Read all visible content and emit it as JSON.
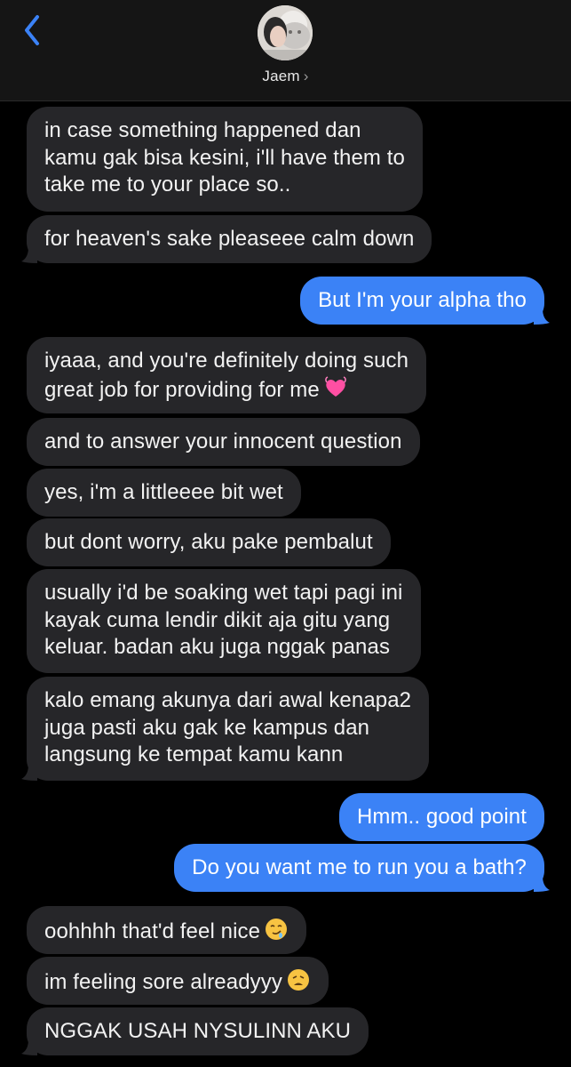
{
  "header": {
    "back_label": "back",
    "contact_name": "Jaem",
    "contact_chevron": "›"
  },
  "messages": [
    {
      "dir": "in",
      "lines": [
        "in case something happened dan",
        "kamu gak bisa kesini, i'll have them to",
        "take me to your place so.."
      ]
    },
    {
      "dir": "in",
      "lines": [
        "for heaven's sake pleaseee calm down"
      ]
    },
    {
      "dir": "out",
      "lines": [
        "But I'm your alpha tho"
      ]
    },
    {
      "dir": "in",
      "lines": [
        "iyaaa, and you're definitely doing such",
        "great job for providing for me"
      ],
      "emoji": "heart"
    },
    {
      "dir": "in",
      "lines": [
        "and to answer your innocent question"
      ]
    },
    {
      "dir": "in",
      "lines": [
        "yes, i'm a littleeee bit wet"
      ]
    },
    {
      "dir": "in",
      "lines": [
        "but dont worry, aku pake pembalut"
      ]
    },
    {
      "dir": "in",
      "lines": [
        "usually i'd be soaking wet tapi pagi ini",
        "kayak cuma lendir dikit aja gitu yang",
        "keluar. badan aku juga nggak panas"
      ]
    },
    {
      "dir": "in",
      "lines": [
        "kalo emang akunya dari awal kenapa2",
        "juga pasti aku gak ke kampus dan",
        "langsung ke tempat kamu kann"
      ]
    },
    {
      "dir": "out",
      "lines": [
        "Hmm.. good point"
      ]
    },
    {
      "dir": "out",
      "lines": [
        "Do you want me to run you a bath?"
      ]
    },
    {
      "dir": "in",
      "lines": [
        "oohhhh that'd feel nice"
      ],
      "emoji": "drooling-face"
    },
    {
      "dir": "in",
      "lines": [
        "im feeling sore alreadyyy"
      ],
      "emoji": "weary-face"
    },
    {
      "dir": "in",
      "lines": [
        "NGGAK USAH NYSULINN AKU"
      ]
    }
  ],
  "colors": {
    "incoming_bubble": "#262629",
    "outgoing_bubble": "#3b82f6",
    "accent": "#3b82f6"
  },
  "icons": [
    "back-chevron-icon",
    "avatar",
    "chevron-right-icon",
    "heart-emoji-icon",
    "drooling-face-emoji-icon",
    "weary-face-emoji-icon"
  ]
}
